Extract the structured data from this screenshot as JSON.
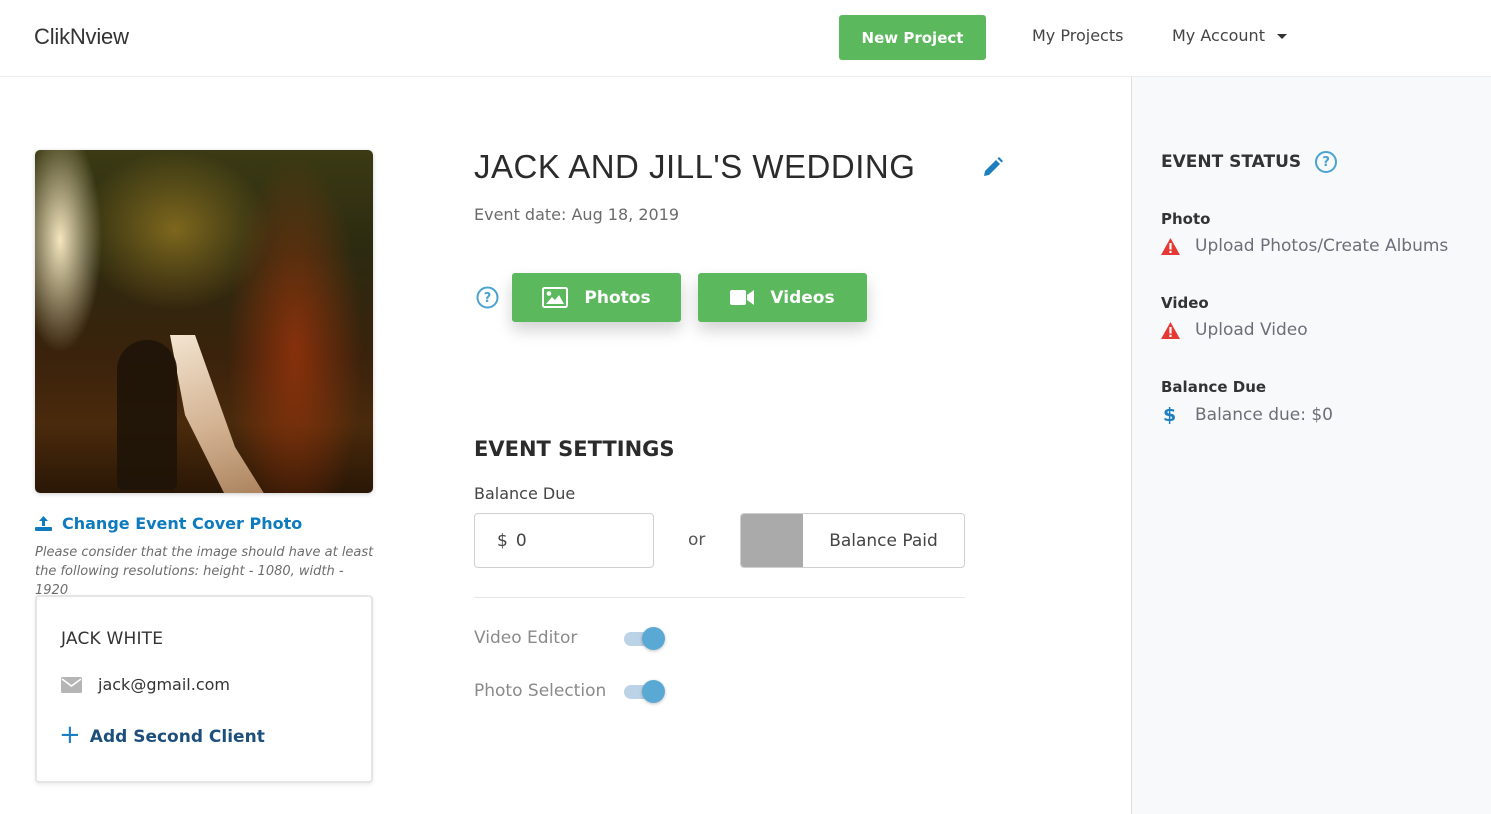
{
  "header": {
    "logo": "ClikNview",
    "new_project_label": "New Project",
    "nav": [
      {
        "label": "My Projects"
      },
      {
        "label": "My Account",
        "has_dropdown": true
      }
    ]
  },
  "colors": {
    "primary_green": "#5cb85c",
    "link_blue": "#0d7bbd",
    "warning_red": "#e53935",
    "toggle_blue": "#5aa9d4"
  },
  "event": {
    "title": "JACK AND JILL'S WEDDING",
    "date_text": "Event date: Aug 18, 2019",
    "media_buttons": [
      {
        "label": "Photos",
        "icon": "image-icon"
      },
      {
        "label": "Videos",
        "icon": "video-camera-icon"
      }
    ]
  },
  "cover": {
    "change_label": "Change Event Cover Photo",
    "note": "Please consider that the image should have at least the following resolutions: height - 1080, width - 1920",
    "image_alt": "Wedding couple in sunlit forest"
  },
  "client": {
    "name": "JACK WHITE",
    "email": "jack@gmail.com",
    "add_label": "Add Second Client"
  },
  "settings": {
    "title": "EVENT SETTINGS",
    "balance_label": "Balance Due",
    "currency_symbol": "$",
    "balance_value": "0",
    "or_text": "or",
    "balance_paid_label": "Balance Paid",
    "balance_paid_checked": false,
    "toggles": [
      {
        "label": "Video Editor",
        "on": true
      },
      {
        "label": "Photo Selection",
        "on": true
      }
    ]
  },
  "status": {
    "title": "EVENT STATUS",
    "groups": [
      {
        "label": "Photo",
        "text": "Upload Photos/Create Albums",
        "icon": "warning-icon"
      },
      {
        "label": "Video",
        "text": "Upload Video",
        "icon": "warning-icon"
      },
      {
        "label": "Balance Due",
        "text": "Balance due: $0",
        "icon": "dollar-icon"
      }
    ]
  }
}
